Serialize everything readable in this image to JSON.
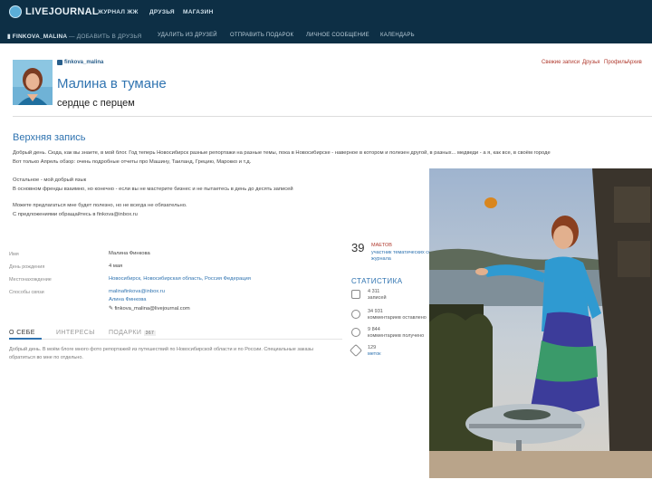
{
  "header": {
    "logo_text": "LIVEJOURNAL",
    "nav": [
      "ЖУРНАЛ ЖЖ",
      "ДРУЗЬЯ",
      "МАГАЗИН"
    ],
    "username": "FINKOVA_MALINA",
    "add_friend": "ДОБАВИТЬ В ДРУЗЬЯ",
    "actions": [
      "УДАЛИТЬ ИЗ ДРУЗЕЙ",
      "ОТПРАВИТЬ ПОДАРОК",
      "ЛИЧНОЕ СООБЩЕНИЕ",
      "КАЛЕНДАРЬ"
    ]
  },
  "journal": {
    "user_link": "finkova_malina",
    "title": "Малина в тумане",
    "subtitle": "сердце с перцем",
    "header_links": [
      "Свежие записи",
      "Друзья",
      "Профиль",
      "Архив"
    ]
  },
  "top_post": {
    "heading": "Верхняя запись",
    "line1": "Добрый день. Сюда, как вы знаете, в мой блог. Год теперь Новосибирск разные репортажи на разные темы, пока в Новосибирске - наверное в котором и полезен другой, в разных... медведи - а я, как все, в своём городе",
    "line2": "Вот только Апрель обзор: очень подробные отчеты про Машину, Таиланд, Грецию, Марокко и т.д.",
    "line3": "Остальное - мой добрый язык",
    "line4": "В основном френды взаимно, но конечно - если вы не мастерите бизнес и не пытаетесь в день до десять записей",
    "line5": "Можете предлагаться мне будет полезно, но не всегда не обязательно.",
    "line6": "С предложениями обращайтесь в finkova@inbox.ru"
  },
  "profile": {
    "labels": [
      "Имя",
      "День рождения",
      "Местонахождение",
      "Способы связи"
    ],
    "name": "Малина Финкова",
    "birthday": "4 мая",
    "location": "Новосибирск, Новосибирская область, Россия Федерация",
    "contacts": [
      "malinafinkova@inbox.ru",
      "Алина Финкова",
      "finkova_malina@livejournal.com"
    ]
  },
  "tabs": {
    "about": "О СЕБЕ",
    "interests": "ИНТЕРЕСЫ",
    "gifts": "ПОДАРКИ",
    "gifts_count": "367"
  },
  "about": {
    "line1": "Добрый день. В моём блоге много фото репортажей из путешествий по Новосибирской области и по России. Специальные заказы",
    "line2": "обратиться во мне по отдельно."
  },
  "stats": {
    "number": "39",
    "unit": "МАЕТОВ",
    "unit_caption": "участник тематических сообществ журнала",
    "heading": "СТАТИСТИКА",
    "items": [
      {
        "value": "4 311",
        "label": "записей",
        "icon": "pencil-icon"
      },
      {
        "value": "34 931",
        "label": "комментариев оставлено",
        "icon": "clock-icon"
      },
      {
        "value": "9 844",
        "label": "комментариев получено",
        "icon": "chat-icon"
      },
      {
        "value": "129",
        "label": "меток",
        "icon": "tag-icon"
      }
    ]
  },
  "colors": {
    "header_bg": "#0d2f45",
    "title_blue": "#2f73b0",
    "link_red": "#b03a2e"
  }
}
